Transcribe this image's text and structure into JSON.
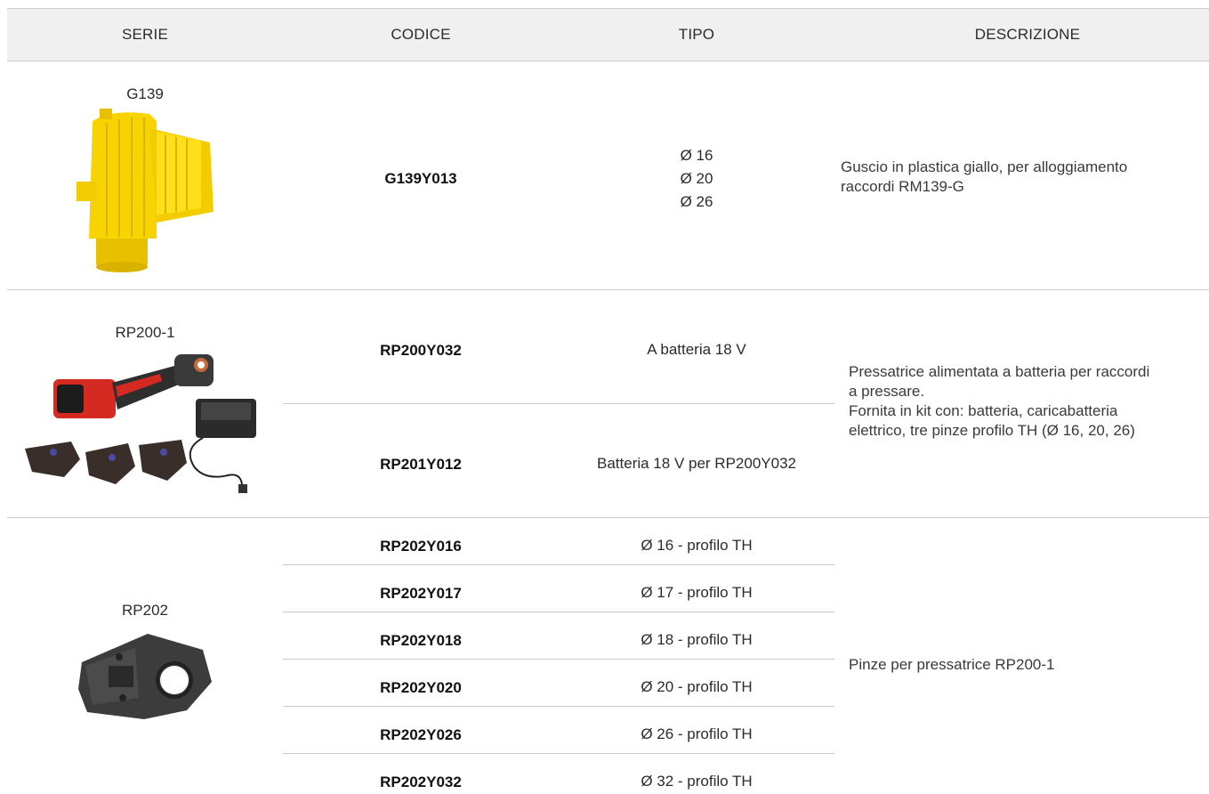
{
  "headers": {
    "serie": "SERIE",
    "codice": "CODICE",
    "tipo": "TIPO",
    "descrizione": "DESCRIZIONE"
  },
  "rows": {
    "g139": {
      "serie": "G139",
      "codice": "G139Y013",
      "tipo": [
        "Ø 16",
        "Ø 20",
        "Ø 26"
      ],
      "descrizione": [
        "Guscio in plastica giallo, per alloggiamento",
        "raccordi RM139-G"
      ]
    },
    "rp200": {
      "serie": "RP200-1",
      "items": [
        {
          "codice": "RP200Y032",
          "tipo": "A batteria 18 V"
        },
        {
          "codice": "RP201Y012",
          "tipo": "Batteria 18 V per RP200Y032"
        }
      ],
      "descrizione": [
        "Pressatrice alimentata a batteria per raccordi",
        "a pressare.",
        "Fornita in kit con: batteria, caricabatteria",
        "elettrico, tre pinze profilo TH (Ø 16, 20, 26)"
      ]
    },
    "rp202": {
      "serie": "RP202",
      "items": [
        {
          "codice": "RP202Y016",
          "tipo": "Ø 16 - profilo TH"
        },
        {
          "codice": "RP202Y017",
          "tipo": "Ø 17 - profilo TH"
        },
        {
          "codice": "RP202Y018",
          "tipo": "Ø 18 - profilo TH"
        },
        {
          "codice": "RP202Y020",
          "tipo": "Ø 20 - profilo TH"
        },
        {
          "codice": "RP202Y026",
          "tipo": "Ø 26 - profilo TH"
        },
        {
          "codice": "RP202Y032",
          "tipo": "Ø 32 - profilo TH"
        }
      ],
      "descrizione": "Pinze per pressatrice RP200-1"
    }
  },
  "colors": {
    "header_bg": "#f0f0f0",
    "divider": "#c9c9c9",
    "shell_yellow": "#f7d400",
    "tool_red": "#d42a22"
  }
}
